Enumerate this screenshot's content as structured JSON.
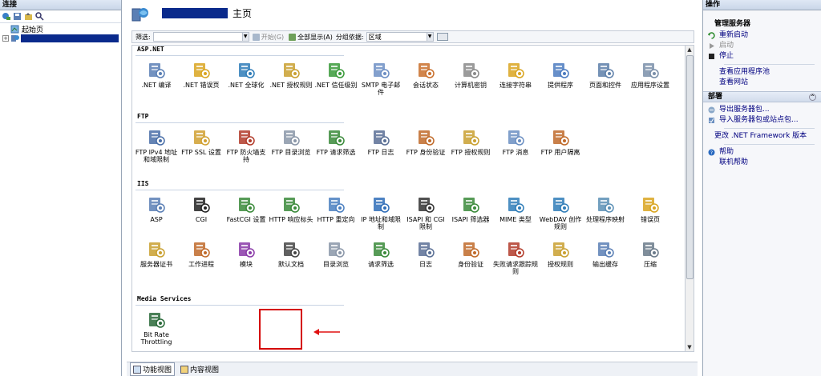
{
  "connections": {
    "title": "连接",
    "tree": [
      {
        "label": "起始页"
      }
    ]
  },
  "header": {
    "title": "主页"
  },
  "filter_bar": {
    "filter_label": "筛选:",
    "start_label": "开始(G)",
    "show_all_label": "全部显示(A)",
    "group_by_label": "分组依据:",
    "group_by_value": "区域"
  },
  "sections": [
    {
      "name": "ASP.NET",
      "tiles": [
        {
          "label": ".NET 编译",
          "icon": "net-compilation-icon",
          "color": "#5a7fb5"
        },
        {
          "label": ".NET 错误页",
          "icon": "net-error-pages-icon",
          "color": "#d9a520"
        },
        {
          "label": ".NET 全球化",
          "icon": "net-globalization-icon",
          "color": "#2f7db8"
        },
        {
          "label": ".NET 授权规则",
          "icon": "net-authorization-icon",
          "color": "#c9a030"
        },
        {
          "label": ".NET 信任级别",
          "icon": "net-trust-levels-icon",
          "color": "#3a9a3a"
        },
        {
          "label": "SMTP 电子邮件",
          "icon": "smtp-email-icon",
          "color": "#6d8fc4"
        },
        {
          "label": "会话状态",
          "icon": "session-state-icon",
          "color": "#c9702d"
        },
        {
          "label": "计算机密钥",
          "icon": "machine-key-icon",
          "color": "#8a8a8a"
        },
        {
          "label": "连接字符串",
          "icon": "connection-strings-icon",
          "color": "#d9a520"
        },
        {
          "label": "提供程序",
          "icon": "providers-icon",
          "color": "#4c7bc0"
        },
        {
          "label": "页面和控件",
          "icon": "pages-controls-icon",
          "color": "#5d7fa9"
        },
        {
          "label": "应用程序设置",
          "icon": "app-settings-icon",
          "color": "#7a8fa9"
        }
      ]
    },
    {
      "name": "FTP",
      "tiles": [
        {
          "label": "FTP IPv4 地址和域限制",
          "icon": "ftp-ip-restrictions-icon",
          "color": "#4a6fa8"
        },
        {
          "label": "FTP SSL 设置",
          "icon": "ftp-ssl-icon",
          "color": "#d0a030"
        },
        {
          "label": "FTP 防火墙支持",
          "icon": "ftp-firewall-icon",
          "color": "#b23b2a"
        },
        {
          "label": "FTP 目录浏览",
          "icon": "ftp-directory-browsing-icon",
          "color": "#8a96a8"
        },
        {
          "label": "FTP 请求筛选",
          "icon": "ftp-request-filtering-icon",
          "color": "#3a8a3a"
        },
        {
          "label": "FTP 日志",
          "icon": "ftp-logging-icon",
          "color": "#5a6f95"
        },
        {
          "label": "FTP 身份验证",
          "icon": "ftp-authentication-icon",
          "color": "#c06a2a"
        },
        {
          "label": "FTP 授权规则",
          "icon": "ftp-authorization-icon",
          "color": "#c9a030"
        },
        {
          "label": "FTP 消息",
          "icon": "ftp-messages-icon",
          "color": "#6b8fc2"
        },
        {
          "label": "FTP 用户隔离",
          "icon": "ftp-user-isolation-icon",
          "color": "#c06a2a"
        }
      ]
    },
    {
      "name": "IIS",
      "tiles": [
        {
          "label": "ASP",
          "icon": "asp-icon",
          "color": "#5a7fb5"
        },
        {
          "label": "CGI",
          "icon": "cgi-icon",
          "color": "#222222"
        },
        {
          "label": "FastCGI 设置",
          "icon": "fastcgi-icon",
          "color": "#3a8a3a"
        },
        {
          "label": "HTTP 响应标头",
          "icon": "http-response-headers-icon",
          "color": "#3a8a3a"
        },
        {
          "label": "HTTP 重定向",
          "icon": "http-redirect-icon",
          "color": "#4a7fc0"
        },
        {
          "label": "IP 地址和域限制",
          "icon": "ip-restrictions-icon",
          "color": "#2f6db8"
        },
        {
          "label": "ISAPI 和 CGI 限制",
          "icon": "isapi-cgi-restrictions-icon",
          "color": "#333333"
        },
        {
          "label": "ISAPI 筛选器",
          "icon": "isapi-filters-icon",
          "color": "#3a8a3a"
        },
        {
          "label": "MIME 类型",
          "icon": "mime-types-icon",
          "color": "#2f7db8"
        },
        {
          "label": "WebDAV 创作规则",
          "icon": "webdav-icon",
          "color": "#2f7db8"
        },
        {
          "label": "处理程序映射",
          "icon": "handler-mappings-icon",
          "color": "#5a8fb5"
        },
        {
          "label": "错误页",
          "icon": "error-pages-icon",
          "color": "#d9a520"
        },
        {
          "label": "服务器证书",
          "icon": "server-certificates-icon",
          "color": "#c9a030"
        },
        {
          "label": "工作进程",
          "icon": "worker-processes-icon",
          "color": "#c06a2a"
        },
        {
          "label": "模块",
          "icon": "modules-icon",
          "color": "#8a3aa8"
        },
        {
          "label": "默认文档",
          "icon": "default-document-icon",
          "color": "#444444"
        },
        {
          "label": "目录浏览",
          "icon": "directory-browsing-icon",
          "color": "#8a96a8"
        },
        {
          "label": "请求筛选",
          "icon": "request-filtering-icon",
          "color": "#3a8a3a"
        },
        {
          "label": "日志",
          "icon": "logging-icon",
          "color": "#5a6f95"
        },
        {
          "label": "身份验证",
          "icon": "authentication-icon",
          "color": "#c06a2a"
        },
        {
          "label": "失败请求跟踪规则",
          "icon": "failed-request-tracing-icon",
          "color": "#b23b2a"
        },
        {
          "label": "授权规则",
          "icon": "authorization-rules-icon",
          "color": "#c9a030"
        },
        {
          "label": "输出缓存",
          "icon": "output-caching-icon",
          "color": "#5a7fb5"
        },
        {
          "label": "压缩",
          "icon": "compression-icon",
          "color": "#6a7a8a"
        }
      ]
    },
    {
      "name": "Media Services",
      "tiles": [
        {
          "label": "Bit Rate Throttling",
          "icon": "bit-rate-throttling-icon",
          "color": "#2a6a3a"
        }
      ]
    }
  ],
  "view_tabs": [
    {
      "label": "功能视图",
      "active": true
    },
    {
      "label": "内容视图",
      "active": false
    }
  ],
  "actions": {
    "title": "操作",
    "manage_server": {
      "title": "管理服务器",
      "items": [
        {
          "label": "重新启动",
          "icon": "restart-icon",
          "enabled": true
        },
        {
          "label": "启动",
          "icon": "start-icon",
          "enabled": false
        },
        {
          "label": "停止",
          "icon": "stop-icon",
          "enabled": true
        }
      ],
      "links": [
        {
          "label": "查看应用程序池"
        },
        {
          "label": "查看网站"
        }
      ]
    },
    "deploy": {
      "title": "部署",
      "items": [
        {
          "label": "导出服务器包...",
          "icon": "export-package-icon"
        },
        {
          "label": "导入服务器包或站点包...",
          "icon": "import-package-icon"
        }
      ],
      "change_framework": "更改 .NET Framework 版本"
    },
    "help": {
      "items": [
        {
          "label": "帮助",
          "icon": "help-icon"
        },
        {
          "label": "联机帮助"
        }
      ]
    }
  }
}
